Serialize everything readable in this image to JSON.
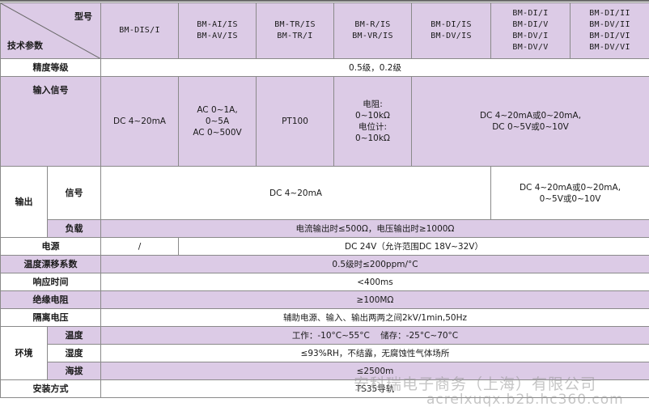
{
  "header": {
    "model_label": "型号",
    "param_label": "技术参数",
    "models": [
      [
        "BM-DIS/I"
      ],
      [
        "BM-AI/IS",
        "BM-AV/IS"
      ],
      [
        "BM-TR/IS",
        "BM-TR/I"
      ],
      [
        "BM-R/IS",
        "BM-VR/IS"
      ],
      [
        "BM-DI/IS",
        "BM-DV/IS"
      ],
      [
        "BM-DI/I",
        "BM-DI/V",
        "BM-DV/I",
        "BM-DV/V"
      ],
      [
        "BM-DI/II",
        "BM-DV/II",
        "BM-DI/VI",
        "BM-DV/VI"
      ]
    ]
  },
  "rows": {
    "accuracy": {
      "label": "精度等级",
      "value": "0.5级，0.2级"
    },
    "input": {
      "label": "输入信号",
      "c1": "DC 4~20mA",
      "c2": [
        "AC 0~1A,",
        "0~5A",
        "AC 0~500V"
      ],
      "c3": "PT100",
      "c4": [
        "电阻:",
        "0~10kΩ",
        "电位计:",
        "0~10kΩ"
      ],
      "c5": [
        "DC 4~20mA或0~20mA,",
        "DC 0~5V或0~10V"
      ]
    },
    "output": {
      "label": "输出",
      "signal_label": "信号",
      "signal_value": "DC 4~20mA",
      "signal_value_alt": [
        "DC 4~20mA或0~20mA,",
        "0~5V或0~10V"
      ],
      "load_label": "负载",
      "load_value": "电流输出时≤500Ω，电压输出时≥1000Ω"
    },
    "power": {
      "label": "电源",
      "c1": "/",
      "value": "DC 24V（允许范围DC 18V~32V）"
    },
    "drift": {
      "label": "温度漂移系数",
      "value": "0.5级时≤200ppm/°C"
    },
    "response": {
      "label": "响应时间",
      "value": "<400ms"
    },
    "insulation": {
      "label": "绝缘电阻",
      "value": "≥100MΩ"
    },
    "isolation": {
      "label": "隔离电压",
      "value": "辅助电源、输入、输出两两之间2kV/1min,50Hz"
    },
    "environment": {
      "label": "环境",
      "temp_label": "温度",
      "temp_value": "工作：-10°C~55°C    储存：-25°C~70°C",
      "humidity_label": "湿度",
      "humidity_value": "≤93%RH，不结露，无腐蚀性气体场所",
      "altitude_label": "海拔",
      "altitude_value": "≤2500m"
    },
    "mounting": {
      "label": "安装方式",
      "value": "TS35导轨"
    }
  },
  "watermark": {
    "line1": "安科瑞电子商务（上海）有限公司",
    "line2": "acrelxuqx.b2b.hc360.com"
  },
  "colors": {
    "row_purple": "#dccbe6",
    "border": "#8a8a8a"
  }
}
